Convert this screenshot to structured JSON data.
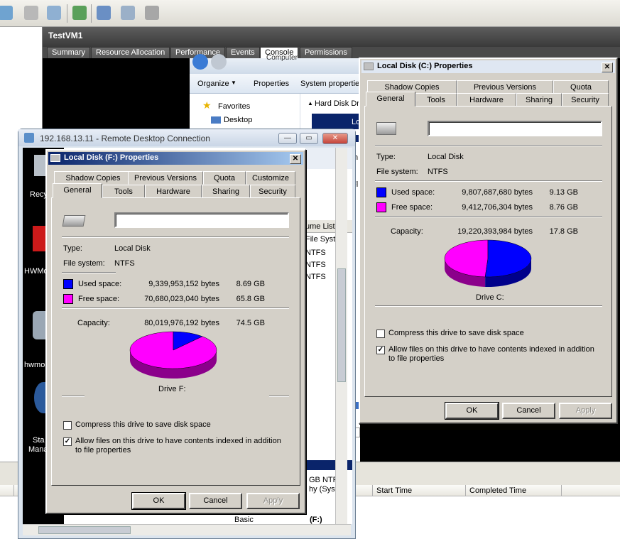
{
  "vm": {
    "name": "TestVM1",
    "tabs": [
      "Summary",
      "Resource Allocation",
      "Performance",
      "Events",
      "Console",
      "Permissions"
    ]
  },
  "explorer": {
    "computer_label": "Computer",
    "organize": "Organize",
    "properties": "Properties",
    "system_properties": "System propertie",
    "favorites": "Favorites",
    "desktop": "Desktop",
    "hard_disk_drives": "Hard Disk Driv",
    "fs_rows": [
      "NTFS",
      "NTFS",
      "NTFS"
    ],
    "col_volume_list": "ume List",
    "col_file_system": "File Syste",
    "capacity_line": "GB NTFS",
    "health_line": "hy (Syste",
    "basic": "Basic",
    "drive_f_short": "(F:)",
    "selected_item": "Lo",
    "partial_letters": [
      "8.",
      "th",
      "Fl"
    ]
  },
  "tasks": {
    "start_time": "Start Time",
    "completed_time": "Completed Time"
  },
  "rdp": {
    "title": "192.168.13.11 - Remote Desktop Connection",
    "desktop_icons": [
      "Recy",
      "HWMo",
      "hwmo",
      "Sta",
      "Mana"
    ]
  },
  "dialog_f": {
    "title": "Local Disk (F:) Properties",
    "tabs_back": [
      "Shadow Copies",
      "Previous Versions",
      "Quota",
      "Customize"
    ],
    "tabs_front": [
      "General",
      "Tools",
      "Hardware",
      "Sharing",
      "Security"
    ],
    "type_label": "Type:",
    "type_value": "Local Disk",
    "fs_label": "File system:",
    "fs_value": "NTFS",
    "used_label": "Used space:",
    "used_bytes": "9,339,953,152 bytes",
    "used_gb": "8.69 GB",
    "free_label": "Free space:",
    "free_bytes": "70,680,023,040 bytes",
    "free_gb": "65.8 GB",
    "cap_label": "Capacity:",
    "cap_bytes": "80,019,976,192 bytes",
    "cap_gb": "74.5 GB",
    "used_fraction": 0.117,
    "drive_label": "Drive F:",
    "compress": "Compress this drive to save disk space",
    "index": "Allow files on this drive to have contents indexed in addition to file properties",
    "compress_checked": false,
    "index_checked": true,
    "ok": "OK",
    "cancel": "Cancel",
    "apply": "Apply"
  },
  "dialog_c": {
    "title": "Local Disk (C:) Properties",
    "tabs_back": [
      "Shadow Copies",
      "Previous Versions",
      "Quota"
    ],
    "tabs_front": [
      "General",
      "Tools",
      "Hardware",
      "Sharing",
      "Security"
    ],
    "type_label": "Type:",
    "type_value": "Local Disk",
    "fs_label": "File system:",
    "fs_value": "NTFS",
    "used_label": "Used space:",
    "used_bytes": "9,807,687,680 bytes",
    "used_gb": "9.13 GB",
    "free_label": "Free space:",
    "free_bytes": "9,412,706,304 bytes",
    "free_gb": "8.76 GB",
    "cap_label": "Capacity:",
    "cap_bytes": "19,220,393,984 bytes",
    "cap_gb": "17.8 GB",
    "used_fraction": 0.51,
    "drive_label": "Drive C:",
    "compress": "Compress this drive to save disk space",
    "index": "Allow files on this drive to have contents indexed in addition to file properties",
    "compress_checked": false,
    "index_checked": true,
    "ok": "OK",
    "cancel": "Cancel",
    "apply": "Apply"
  },
  "colors": {
    "used": "#0000ff",
    "free": "#ff00ff",
    "used_shadow": "#00008b",
    "free_shadow": "#8b008b"
  }
}
